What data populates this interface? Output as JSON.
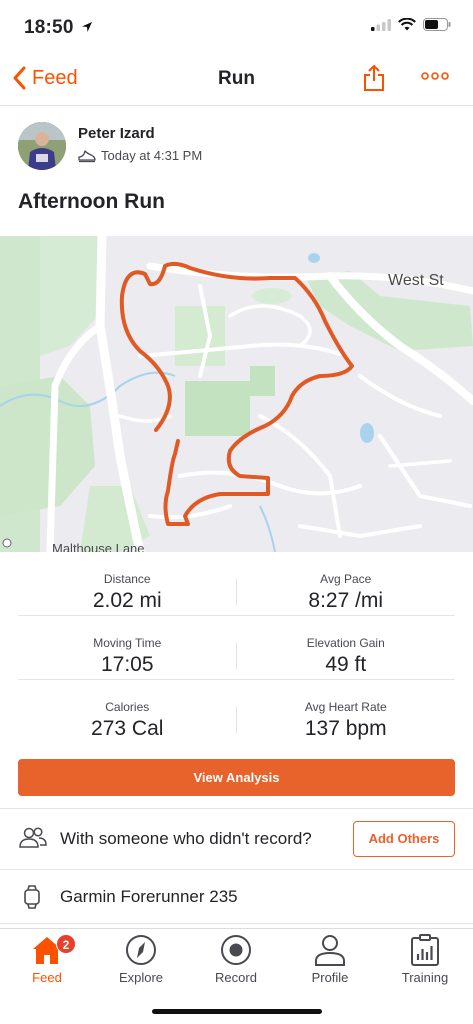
{
  "status": {
    "time": "18:50"
  },
  "nav": {
    "back_label": "Feed",
    "title": "Run"
  },
  "athlete": {
    "name": "Peter Izard",
    "timestamp": "Today at 4:31 PM"
  },
  "activity": {
    "title": "Afternoon Run"
  },
  "map": {
    "street_label": "West St",
    "lane_label": "Malthouse Lane",
    "route_color": "#e05a25"
  },
  "stats": [
    {
      "label": "Distance",
      "value": "2.02 mi"
    },
    {
      "label": "Avg Pace",
      "value": "8:27 /mi"
    },
    {
      "label": "Moving Time",
      "value": "17:05"
    },
    {
      "label": "Elevation Gain",
      "value": "49 ft"
    },
    {
      "label": "Calories",
      "value": "273 Cal"
    },
    {
      "label": "Avg Heart Rate",
      "value": "137 bpm"
    }
  ],
  "actions": {
    "view_analysis": "View Analysis",
    "others_prompt": "With someone who didn't record?",
    "add_others": "Add Others"
  },
  "device": {
    "name": "Garmin Forerunner 235"
  },
  "tabs": [
    {
      "label": "Feed",
      "icon": "home-icon",
      "active": true,
      "badge": "2"
    },
    {
      "label": "Explore",
      "icon": "compass-icon"
    },
    {
      "label": "Record",
      "icon": "record-icon"
    },
    {
      "label": "Profile",
      "icon": "profile-icon"
    },
    {
      "label": "Training",
      "icon": "training-icon"
    }
  ],
  "colors": {
    "accent": "#fc5200",
    "button": "#e8622b",
    "badge": "#e8402b"
  }
}
